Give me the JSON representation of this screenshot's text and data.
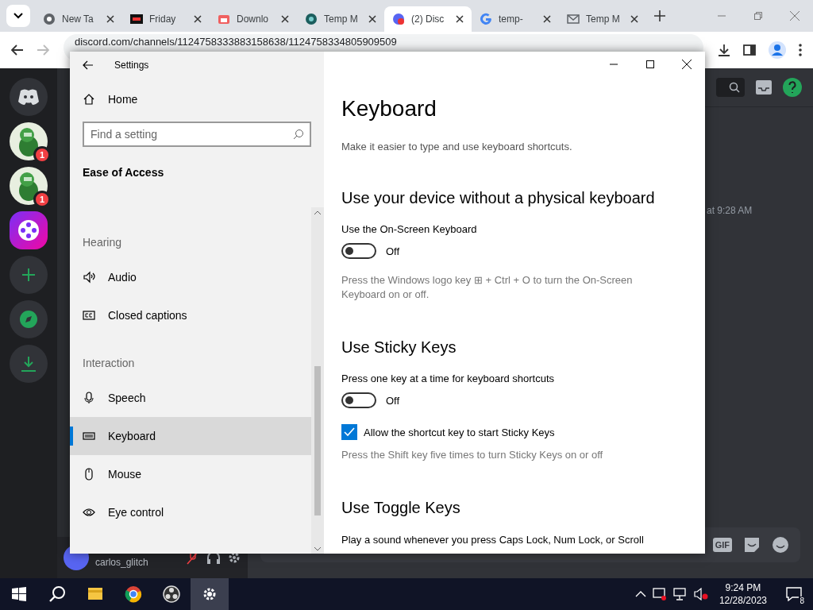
{
  "browser": {
    "tabs": [
      {
        "label": "New Ta",
        "selected": false
      },
      {
        "label": "Friday",
        "selected": false
      },
      {
        "label": "Downlo",
        "selected": false
      },
      {
        "label": "Temp M",
        "selected": false
      },
      {
        "label": "(2) Disc",
        "selected": true
      },
      {
        "label": "temp-",
        "selected": false
      },
      {
        "label": "Temp M",
        "selected": false
      }
    ],
    "url": "discord.com/channels/1124758333883158638/1124758334805909509"
  },
  "discord": {
    "servers": [
      {
        "kind": "home"
      },
      {
        "kind": "avatar",
        "badge": "1"
      },
      {
        "kind": "avatar",
        "badge": "1"
      },
      {
        "kind": "app"
      },
      {
        "kind": "add"
      },
      {
        "kind": "explore"
      },
      {
        "kind": "download"
      }
    ],
    "timestamp": "at 9:28 AM",
    "username": "carlos_glitch",
    "composer_buttons": [
      "GIF"
    ]
  },
  "settings": {
    "title": "Settings",
    "home": "Home",
    "search": {
      "placeholder": "Find a setting"
    },
    "category": "Ease of Access",
    "groups": [
      {
        "heading": "Hearing",
        "items": [
          {
            "label": "Audio",
            "selected": false
          },
          {
            "label": "Closed captions",
            "selected": false
          }
        ]
      },
      {
        "heading": "Interaction",
        "items": [
          {
            "label": "Speech",
            "selected": false
          },
          {
            "label": "Keyboard",
            "selected": true
          },
          {
            "label": "Mouse",
            "selected": false
          },
          {
            "label": "Eye control",
            "selected": false
          }
        ]
      }
    ]
  },
  "page": {
    "title": "Keyboard",
    "description": "Make it easier to type and use keyboard shortcuts.",
    "sections": [
      {
        "heading": "Use your device without a physical keyboard",
        "items": [
          {
            "kind": "toggle",
            "label": "Use the On-Screen Keyboard",
            "on": false,
            "state_label": "Off"
          },
          {
            "kind": "note",
            "text": "Press the Windows logo key ⊞ + Ctrl + O to turn the On-Screen Keyboard on or off."
          }
        ]
      },
      {
        "heading": "Use Sticky Keys",
        "items": [
          {
            "kind": "toggle",
            "label": "Press one key at a time for keyboard shortcuts",
            "on": false,
            "state_label": "Off"
          },
          {
            "kind": "checkbox",
            "label": "Allow the shortcut key to start Sticky Keys",
            "checked": true
          },
          {
            "kind": "note",
            "text": "Press the Shift key five times to turn Sticky Keys on or off"
          }
        ]
      },
      {
        "heading": "Use Toggle Keys",
        "items": [
          {
            "kind": "note_dark",
            "text": "Play a sound whenever you press Caps Lock, Num Lock, or Scroll"
          }
        ]
      }
    ]
  },
  "taskbar": {
    "apps": [
      {
        "selected": false
      },
      {
        "selected": false
      },
      {
        "selected": false
      },
      {
        "selected": true
      }
    ],
    "time": "9:24 PM",
    "date": "12/28/2023",
    "notifications": "8"
  }
}
